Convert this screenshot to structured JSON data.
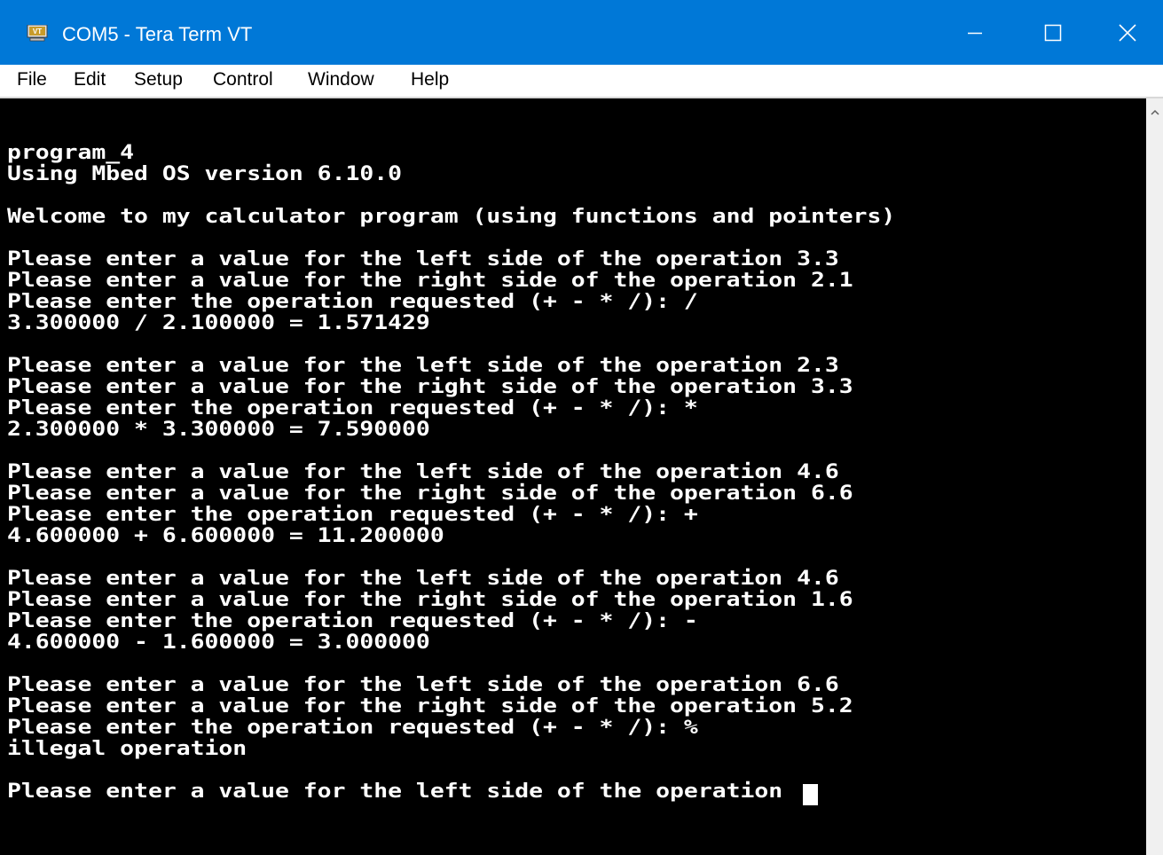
{
  "window": {
    "title": "COM5 - Tera Term VT",
    "icon": "vt-icon",
    "icon_label": "VT"
  },
  "menu": [
    "File",
    "Edit",
    "Setup",
    "Control",
    "Window",
    "Help"
  ],
  "terminal": {
    "lines": [
      "program_4",
      "Using Mbed OS version 6.10.0",
      "",
      "Welcome to my calculator program (using functions and pointers)",
      "",
      "Please enter a value for the left side of the operation 3.3",
      "Please enter a value for the right side of the operation 2.1",
      "Please enter the operation requested (+ - * /): /",
      "3.300000 / 2.100000 = 1.571429",
      "",
      "Please enter a value for the left side of the operation 2.3",
      "Please enter a value for the right side of the operation 3.3",
      "Please enter the operation requested (+ - * /): *",
      "2.300000 * 3.300000 = 7.590000",
      "",
      "Please enter a value for the left side of the operation 4.6",
      "Please enter a value for the right side of the operation 6.6",
      "Please enter the operation requested (+ - * /): +",
      "4.600000 + 6.600000 = 11.200000",
      "",
      "Please enter a value for the left side of the operation 4.6",
      "Please enter a value for the right side of the operation 1.6",
      "Please enter the operation requested (+ - * /): -",
      "4.600000 - 1.600000 = 3.000000",
      "",
      "Please enter a value for the left side of the operation 6.6",
      "Please enter a value for the right side of the operation 5.2",
      "Please enter the operation requested (+ - * /): %",
      "illegal operation",
      "",
      "Please enter a value for the left side of the operation "
    ]
  },
  "colors": {
    "titlebar": "#0078d7",
    "terminal_bg": "#000000",
    "terminal_fg": "#ffffff"
  }
}
